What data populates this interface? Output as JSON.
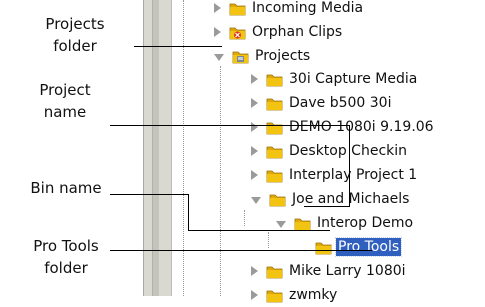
{
  "callouts": {
    "projects_folder": {
      "line1": "Projects",
      "line2": "folder"
    },
    "project_name": {
      "line1": "Project",
      "line2": "name"
    },
    "bin_name": {
      "line1": "Bin name"
    },
    "pro_tools_folder": {
      "line1": "Pro Tools",
      "line2": "folder"
    }
  },
  "tree": {
    "items": [
      {
        "label": "Incoming Media",
        "icon": "folder-icon",
        "state": "collapsed"
      },
      {
        "label": "Orphan Clips",
        "icon": "orphan-clips-icon",
        "state": "collapsed"
      },
      {
        "label": "Projects",
        "icon": "projects-folder-icon",
        "state": "expanded"
      },
      {
        "label": "30i Capture Media",
        "icon": "folder-icon",
        "state": "collapsed"
      },
      {
        "label": "Dave b500 30i",
        "icon": "folder-icon",
        "state": "collapsed"
      },
      {
        "label": "DEMO 1080i 9.19.06",
        "icon": "folder-icon",
        "state": "collapsed"
      },
      {
        "label": "Desktop Checkin",
        "icon": "folder-icon",
        "state": "collapsed"
      },
      {
        "label": "Interplay Project 1",
        "icon": "folder-icon",
        "state": "collapsed"
      },
      {
        "label": "Joe and Michaels",
        "icon": "folder-icon",
        "state": "expanded"
      },
      {
        "label": "Interop Demo",
        "icon": "folder-icon",
        "state": "expanded"
      },
      {
        "label": "Pro Tools",
        "icon": "folder-icon",
        "state": "selected"
      },
      {
        "label": "Mike Larry 1080i",
        "icon": "folder-icon",
        "state": "collapsed"
      },
      {
        "label": "zwmky",
        "icon": "folder-icon",
        "state": "collapsed"
      }
    ]
  },
  "colors": {
    "selection": "#2f5fbf",
    "folder": "#f3c312",
    "orphan_red": "#d83a1c"
  }
}
